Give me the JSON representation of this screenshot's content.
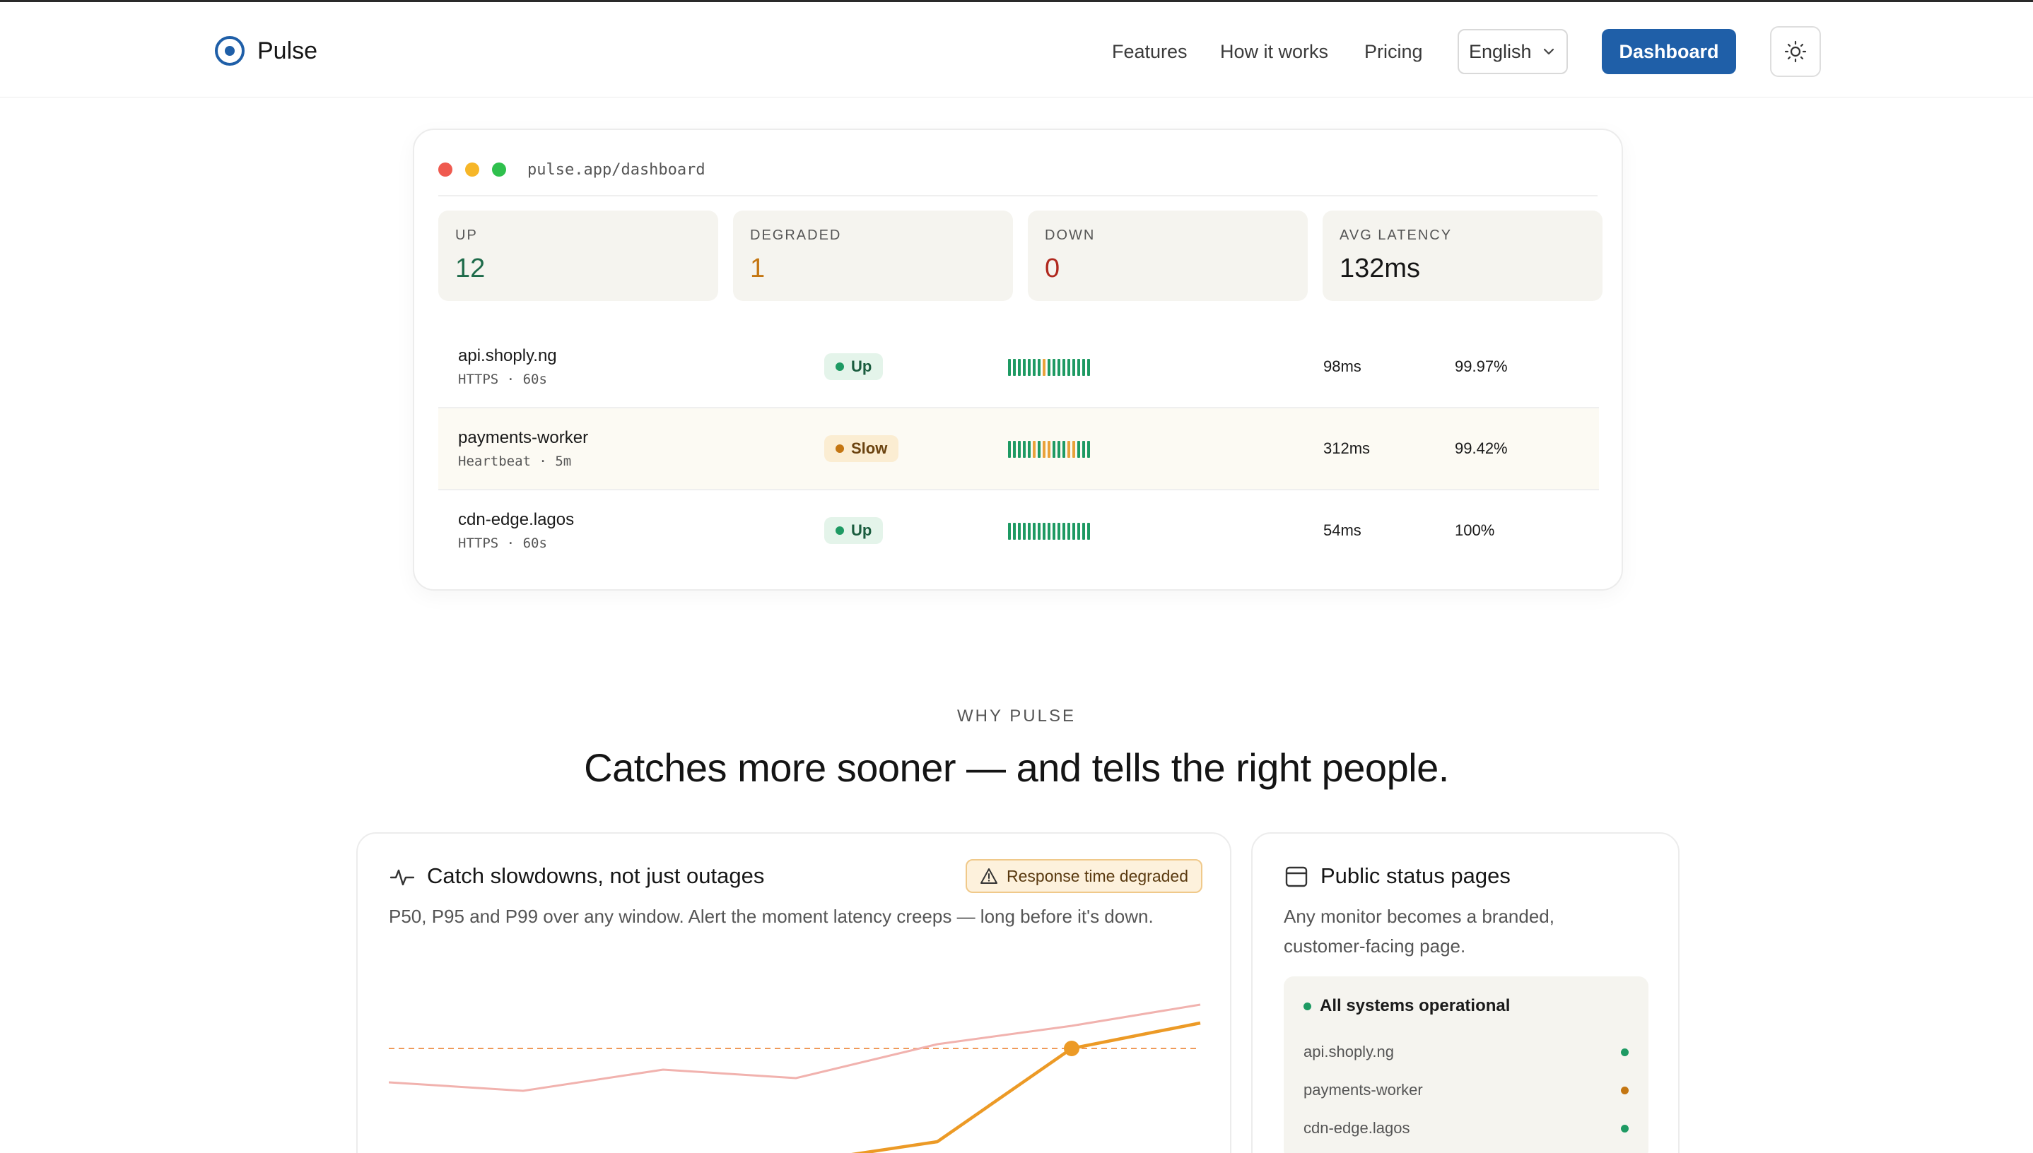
{
  "brand": {
    "name": "Pulse",
    "accent": "#1f5fa8"
  },
  "nav": {
    "links": [
      "Features",
      "How it works",
      "Pricing"
    ],
    "language": "English",
    "dashboard_label": "Dashboard",
    "theme_icon": "sun-icon"
  },
  "dashboard": {
    "url": "pulse.app/dashboard",
    "stats": [
      {
        "label": "UP",
        "value": "12",
        "color": "#1e6b4a"
      },
      {
        "label": "DEGRADED",
        "value": "1",
        "color": "#c47612"
      },
      {
        "label": "DOWN",
        "value": "0",
        "color": "#b0281e"
      },
      {
        "label": "AVG LATENCY",
        "value": "132ms",
        "color": "#161616"
      }
    ],
    "monitors": [
      {
        "name": "api.shoply.ng",
        "type": "HTTPS",
        "interval": "60s",
        "status": "Up",
        "latency": "98ms",
        "uptime": "99.97%",
        "history": [
          "g",
          "g",
          "g",
          "g",
          "g",
          "g",
          "g",
          "o",
          "g",
          "g",
          "g",
          "g",
          "g",
          "g",
          "g",
          "g",
          "g"
        ]
      },
      {
        "name": "payments-worker",
        "type": "Heartbeat",
        "interval": "5m",
        "status": "Slow",
        "latency": "312ms",
        "uptime": "99.42%",
        "history": [
          "g",
          "g",
          "g",
          "g",
          "g",
          "o",
          "g",
          "o",
          "o",
          "g",
          "g",
          "g",
          "o",
          "o",
          "g",
          "g",
          "g"
        ]
      },
      {
        "name": "cdn-edge.lagos",
        "type": "HTTPS",
        "interval": "60s",
        "status": "Up",
        "latency": "54ms",
        "uptime": "100%",
        "history": [
          "g",
          "g",
          "g",
          "g",
          "g",
          "g",
          "g",
          "g",
          "g",
          "g",
          "g",
          "g",
          "g",
          "g",
          "g",
          "g",
          "g"
        ]
      }
    ],
    "meta_separator": "·"
  },
  "why": {
    "eyebrow": "WHY PULSE",
    "headline": "Catches more sooner — and tells the right people."
  },
  "feature_latency": {
    "title": "Catch slowdowns, not just outages",
    "badge": "Response time degraded",
    "description": "P50, P95 and P99 over any window. Alert the moment latency creeps — long before it's down."
  },
  "feature_status": {
    "title": "Public status pages",
    "description_line1": "Any monitor becomes a branded,",
    "description_line2": "customer-facing page.",
    "overall": "All systems operational",
    "items": [
      {
        "name": "api.shoply.ng",
        "color": "#1e9a63"
      },
      {
        "name": "payments-worker",
        "color": "#c47612"
      },
      {
        "name": "cdn-edge.lagos",
        "color": "#1e9a63"
      }
    ]
  },
  "colors": {
    "up": "#1e9a63",
    "slow": "#e9a23b",
    "up_badge_bg": "#e4f4ea",
    "slow_badge_bg": "#fbedd2"
  }
}
